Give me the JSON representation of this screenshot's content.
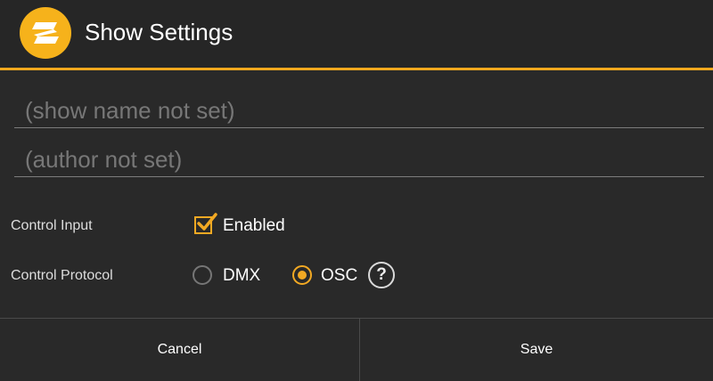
{
  "header": {
    "title": "Show Settings",
    "icon": "app-logo-icon",
    "accent_color": "#f0a81e"
  },
  "fields": {
    "show_name": {
      "value": "",
      "placeholder": "(show name not set)"
    },
    "author": {
      "value": "",
      "placeholder": "(author not set)"
    }
  },
  "control_input": {
    "label": "Control Input",
    "checkbox_label": "Enabled",
    "checked": true
  },
  "control_protocol": {
    "label": "Control Protocol",
    "options": [
      {
        "label": "DMX",
        "selected": false
      },
      {
        "label": "OSC",
        "selected": true
      }
    ],
    "help_label": "?"
  },
  "footer": {
    "cancel_label": "Cancel",
    "save_label": "Save"
  }
}
